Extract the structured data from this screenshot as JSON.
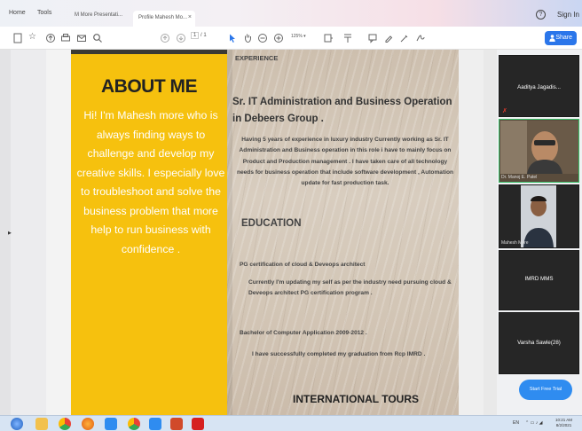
{
  "browser": {
    "menu": [
      "Home",
      "Tools"
    ],
    "tabs": [
      {
        "label": "M More Presentati..."
      },
      {
        "label": "Profile Mahesh Mo..."
      }
    ],
    "sign_in": "Sign In"
  },
  "toolbar": {
    "page_current": "1",
    "page_total": "/ 1",
    "zoom": "125%",
    "share_label": "Share"
  },
  "document": {
    "about_title": "ABOUT ME",
    "about_text": "Hi! I'm Mahesh more  who is always finding ways to challenge and develop my creative skills. I especially love to troubleshoot and solve the business problem that more help to run business with confidence .",
    "experience_heading": "EXPERIENCE",
    "job_title": "Sr. IT Administration and Business Operation  in Debeers Group .",
    "job_description": "Having 5 years of experience in luxury industry Currently working as  Sr. IT Administration and Business  operation in this role i have to mainly focus on Product and Production management .  I have taken care of all technology  needs for business operation that include software development  ,  Automation update for fast production task.",
    "education_heading": "EDUCATION",
    "pg_line": "PG certification of  cloud  & Deveops architect",
    "pg_description": "Currently I'm updating my self  as per the industry need pursuing cloud  & Deveops architect PG certification program .",
    "bca_line": "Bachelor of Computer Application  2009-2012 .",
    "bca_description": "I have successfully completed  my graduation from Rcp IMRD  .",
    "tours_heading": "INTERNATIONAL TOURS"
  },
  "meeting": {
    "participants": [
      {
        "name": "Aaditya  Jagadis..."
      },
      {
        "name": "Dr. Manoj E. Patel"
      },
      {
        "name": "Mahesh More"
      },
      {
        "name": "IMRD MMS"
      },
      {
        "name": "Varsha Sawle(28)"
      }
    ],
    "trial_button": "Start Free Trial"
  },
  "taskbar": {
    "tray_lang": "EN",
    "time": "10:21 AM",
    "date": "8/2/2021"
  },
  "colors": {
    "accent": "#2b76ea",
    "about_bg": "#f6c10e",
    "taskbar": "#d7e4f3"
  }
}
